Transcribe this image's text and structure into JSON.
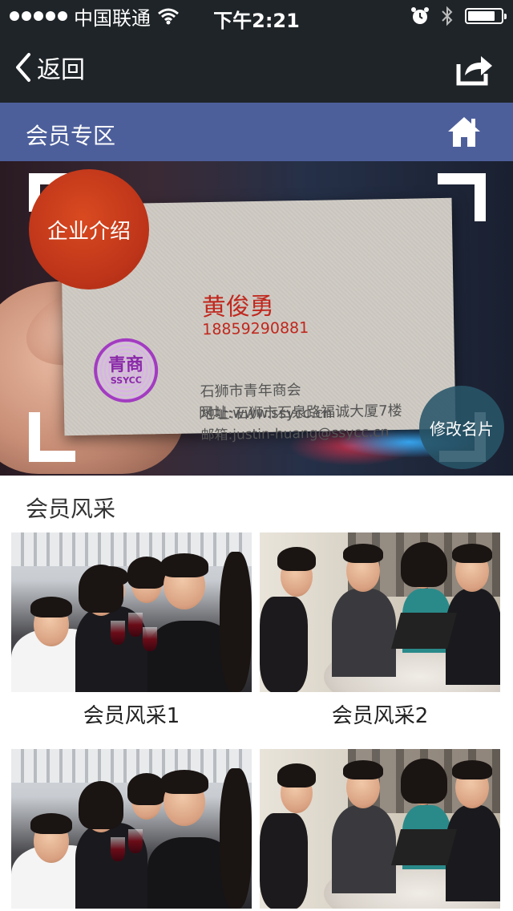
{
  "status_bar": {
    "carrier": "中国联通",
    "time": "下午2:21",
    "battery_level": 0.85
  },
  "nav": {
    "back_label": "返回",
    "back_icon": "chevron-left-icon",
    "share_icon": "share-icon"
  },
  "section_bar": {
    "title": "会员专区",
    "home_icon": "home-icon"
  },
  "banner": {
    "intro_button": "企业介绍",
    "edit_button": "修改名片",
    "card": {
      "name": "黄俊勇",
      "phone": "18859290881",
      "org": "石狮市青年商会",
      "address": "地址:石狮市石泉路福诚大厦7楼",
      "email": "邮箱:justin-huang@ssycc.cn",
      "website": "网址:www.ssycc.cn",
      "logo_text": "青商",
      "logo_sub": "SSYCC"
    }
  },
  "gallery": {
    "title": "会员风采",
    "items": [
      {
        "caption": "会员风采1"
      },
      {
        "caption": "会员风采2"
      }
    ]
  },
  "colors": {
    "dark_bar": "#1f2428",
    "section_bar": "#4d5f9b",
    "intro_button": "#c0361a",
    "edit_button": "#285569",
    "card_accent": "#c0281e"
  }
}
